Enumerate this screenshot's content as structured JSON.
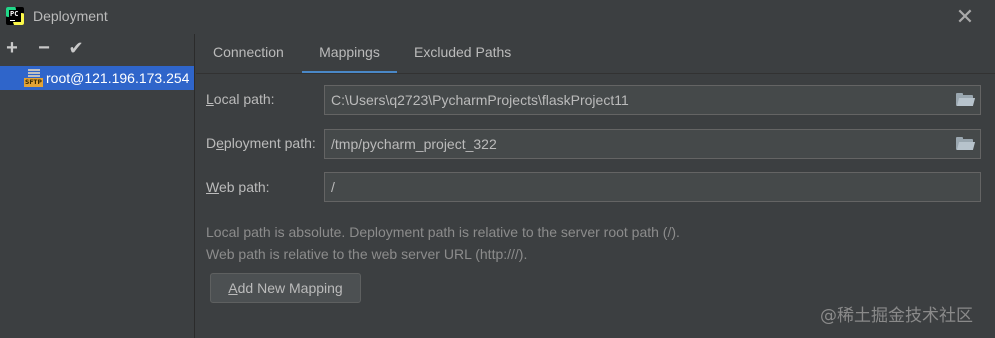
{
  "window": {
    "title": "Deployment",
    "close_glyph": "✕",
    "app_icon_text": "PC"
  },
  "toolbar": {
    "add_glyph": "+",
    "remove_glyph": "−",
    "check_glyph": "✔"
  },
  "servers": {
    "items": [
      {
        "label": "root@121.196.173.254",
        "icon": "sftp-server-icon",
        "icon_text": "SFTP",
        "selected": true
      }
    ]
  },
  "tabs": [
    {
      "label": "Connection",
      "active": false
    },
    {
      "label": "Mappings",
      "active": true
    },
    {
      "label": "Excluded Paths",
      "active": false
    }
  ],
  "mappings": {
    "local_path": {
      "mnemonic": "L",
      "label_rest": "ocal path:",
      "value": "C:\\Users\\q2723\\PycharmProjects\\flaskProject11",
      "icon": "folder-icon"
    },
    "deployment_path": {
      "label_pre": "D",
      "mnemonic": "e",
      "label_rest": "ployment path:",
      "value": "/tmp/pycharm_project_322",
      "icon": "folder-icon"
    },
    "web_path": {
      "mnemonic": "W",
      "label_rest": "eb path:",
      "value": "/"
    },
    "help_line1": "Local path is absolute. Deployment path is relative to the server root path (/).",
    "help_line2": "Web path is relative to the web server URL (http:///).",
    "add_button": {
      "mnemonic": "A",
      "label_rest": "dd New Mapping"
    }
  },
  "watermark": "@稀土掘金技术社区",
  "colors": {
    "background": "#3c3f41",
    "selection": "#2f65ca",
    "tab_underline": "#4a88c7",
    "field_bg": "#45494a"
  }
}
